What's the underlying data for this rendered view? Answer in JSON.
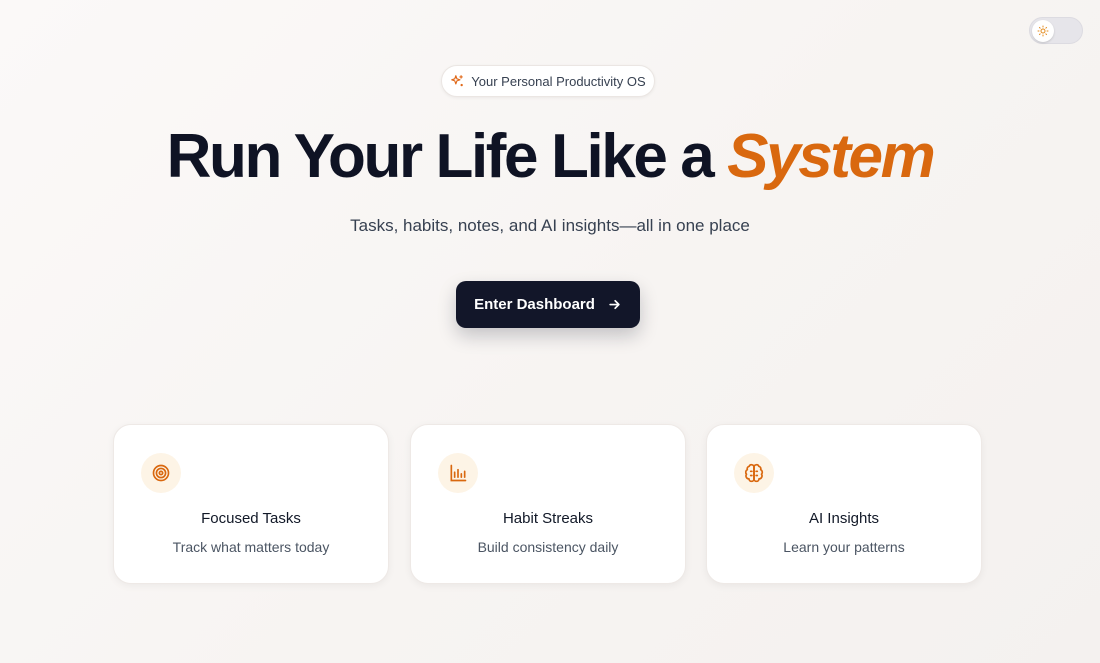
{
  "theme_toggle": {
    "icon": "sun-icon",
    "state": "light"
  },
  "badge": {
    "icon": "sparkle-icon",
    "label": "Your Personal Productivity OS"
  },
  "hero": {
    "headline_main": "Run Your Life Like a ",
    "headline_accent": "System",
    "subtitle": "Tasks, habits, notes, and AI insights—all in one place"
  },
  "cta": {
    "label": "Enter Dashboard",
    "icon": "arrow-right-icon"
  },
  "features": [
    {
      "icon": "target-icon",
      "title": "Focused Tasks",
      "description": "Track what matters today"
    },
    {
      "icon": "bar-chart-icon",
      "title": "Habit Streaks",
      "description": "Build consistency daily"
    },
    {
      "icon": "brain-icon",
      "title": "AI Insights",
      "description": "Learn your patterns"
    }
  ],
  "colors": {
    "accent": "#d9680f",
    "primary": "#121629",
    "icon_bg": "#fdf4e6"
  }
}
